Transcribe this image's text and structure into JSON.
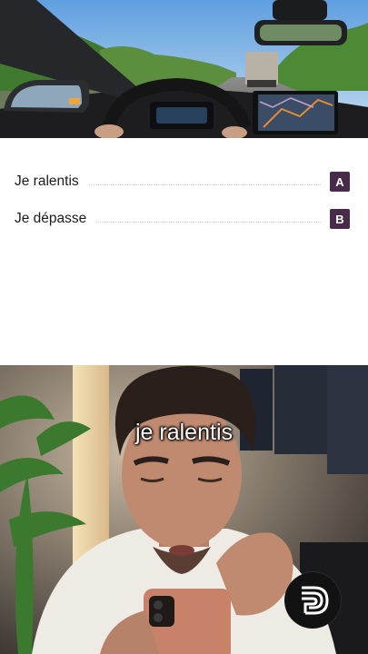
{
  "question": {
    "options": [
      {
        "label": "Je ralentis",
        "key": "A"
      },
      {
        "label": "Je dépasse",
        "key": "B"
      }
    ]
  },
  "video": {
    "caption": "je ralentis"
  },
  "colors": {
    "key_badge": "#4a2a4a",
    "sky": "#8fc0e8",
    "foliage": "#4e8a3a"
  },
  "icons": [
    "rearview-mirror-icon",
    "side-mirror-icon",
    "steering-wheel-icon",
    "gps-screen-icon",
    "brand-logo-icon"
  ]
}
